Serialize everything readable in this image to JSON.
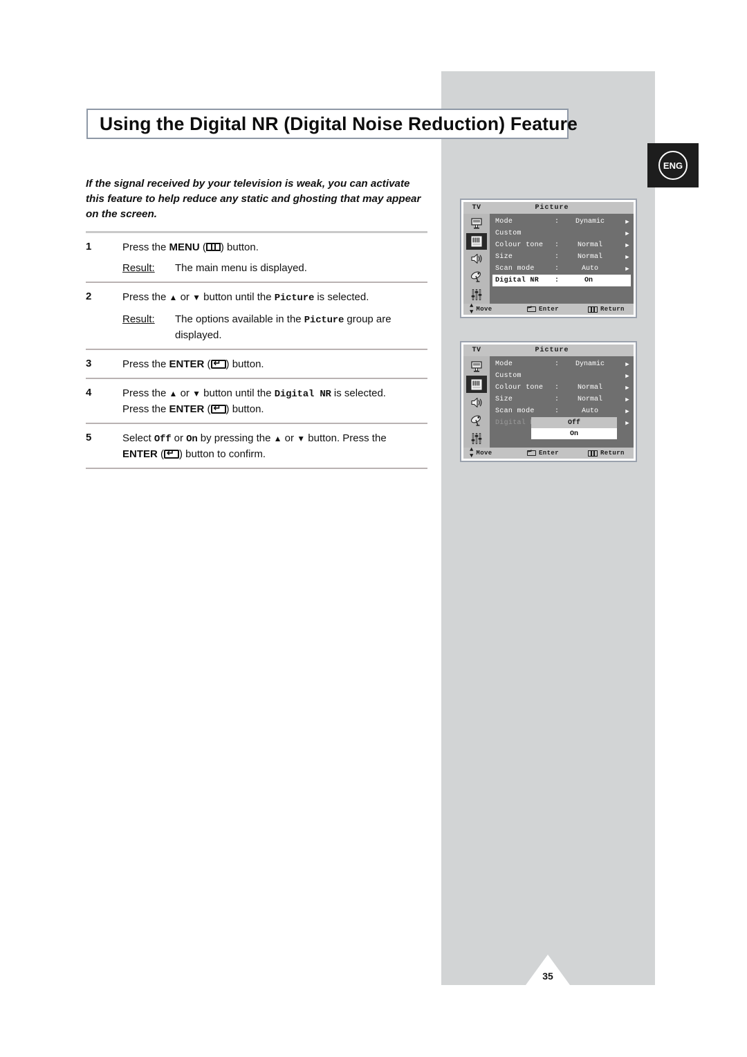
{
  "page": {
    "title": "Using the Digital NR (Digital Noise Reduction) Feature",
    "language_badge": "ENG",
    "page_number": "35",
    "band_color": "#d2d4d5",
    "title_border_color": "#8e98a6"
  },
  "intro": {
    "line1": "If the signal received by your television is weak, you can activate",
    "line2": "this feature to help reduce any static and ghosting that may appear",
    "line3": "on the screen."
  },
  "steps": [
    {
      "num": "1",
      "text_a": "Press the ",
      "bold_a": "MENU",
      "text_b": " (",
      "icon": "menu-icon",
      "text_c": ")  button.",
      "result_label": "Result:",
      "result_text": "The main menu is displayed."
    },
    {
      "num": "2",
      "text_a": "Press the ",
      "arrow_up": "▲",
      "text_or": " or ",
      "arrow_down": "▼",
      "text_b": " button until the ",
      "mono": "Picture",
      "text_c": " is selected.",
      "result_label": "Result:",
      "result_text_a": "The options available in the ",
      "result_mono": "Picture",
      "result_text_b": " group are",
      "result_text_c": "displayed."
    },
    {
      "num": "3",
      "text_a": "Press the ",
      "bold_a": "ENTER",
      "text_b": " (",
      "icon": "enter-icon",
      "text_c": ") button."
    },
    {
      "num": "4",
      "text_a": "Press the ",
      "arrow_up": "▲",
      "text_or": " or ",
      "arrow_down": "▼",
      "text_b": " button until the ",
      "mono": "Digital NR",
      "text_c": " is selected.",
      "line2_a": "Press the ",
      "line2_bold": "ENTER",
      "line2_b": " (",
      "line2_icon": "enter-icon",
      "line2_c": ") button."
    },
    {
      "num": "5",
      "text_a": "Select ",
      "mono_off": "Off",
      "text_or1": " or ",
      "mono_on": "On",
      "text_b": "  by pressing the ",
      "arrow_up": "▲",
      "text_or": " or ",
      "arrow_down": "▼",
      "text_c": " button. Press the",
      "line2_bold": "ENTER",
      "line2_a": " (",
      "line2_icon": "enter-icon",
      "line2_b": ") button to confirm."
    }
  ],
  "osd": {
    "tv_label": "TV",
    "title": "Picture",
    "rail_icons": [
      "input-source-icon",
      "picture-icon",
      "sound-icon",
      "channel-dish-icon",
      "setup-sliders-icon"
    ],
    "footer": {
      "move": "Move",
      "enter": "Enter",
      "return": "Return"
    },
    "panel1": {
      "rows": [
        {
          "label": "Mode",
          "colon": ":",
          "value": "Dynamic",
          "arrow": "▶",
          "state": "normal"
        },
        {
          "label": "Custom",
          "colon": "",
          "value": "",
          "arrow": "▶",
          "state": "normal"
        },
        {
          "label": "Colour tone",
          "colon": ":",
          "value": "Normal",
          "arrow": "▶",
          "state": "normal"
        },
        {
          "label": "Size",
          "colon": ":",
          "value": "Normal",
          "arrow": "▶",
          "state": "normal"
        },
        {
          "label": "Scan mode",
          "colon": ":",
          "value": "Auto",
          "arrow": "▶",
          "state": "normal"
        },
        {
          "label": "Digital NR",
          "colon": ":",
          "value": "On",
          "arrow": "",
          "state": "selected"
        }
      ]
    },
    "panel2": {
      "rows": [
        {
          "label": "Mode",
          "colon": ":",
          "value": "Dynamic",
          "arrow": "▶",
          "state": "normal"
        },
        {
          "label": "Custom",
          "colon": "",
          "value": "",
          "arrow": "▶",
          "state": "normal"
        },
        {
          "label": "Colour tone",
          "colon": ":",
          "value": "Normal",
          "arrow": "▶",
          "state": "normal"
        },
        {
          "label": "Size",
          "colon": ":",
          "value": "Normal",
          "arrow": "▶",
          "state": "normal"
        },
        {
          "label": "Scan mode",
          "colon": ":",
          "value": "Auto",
          "arrow": "▶",
          "state": "normal"
        },
        {
          "label": "Digital NR",
          "colon": ":",
          "value": "",
          "arrow": "▶",
          "state": "dim"
        }
      ],
      "dropdown": {
        "selected_option": "Off",
        "other_option": "On"
      }
    }
  }
}
